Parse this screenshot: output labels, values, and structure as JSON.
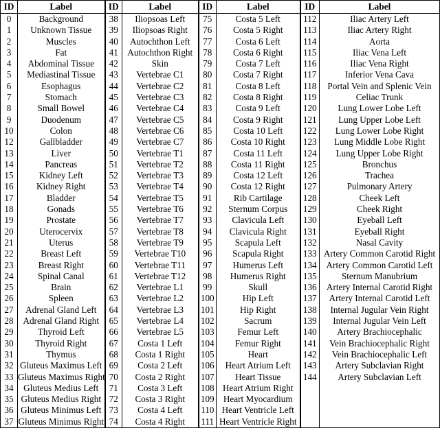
{
  "table": {
    "headers": {
      "id": "ID",
      "label": "Label"
    },
    "column_groups": [
      {
        "rows": [
          {
            "id": "0",
            "label": "Background"
          },
          {
            "id": "1",
            "label": "Unknown Tissue"
          },
          {
            "id": "2",
            "label": "Muscles"
          },
          {
            "id": "3",
            "label": "Fat"
          },
          {
            "id": "4",
            "label": "Abdominal Tissue"
          },
          {
            "id": "5",
            "label": "Mediastinal Tissue"
          },
          {
            "id": "6",
            "label": "Esophagus"
          },
          {
            "id": "7",
            "label": "Stomach"
          },
          {
            "id": "8",
            "label": "Small Bowel"
          },
          {
            "id": "9",
            "label": "Duodenum"
          },
          {
            "id": "10",
            "label": "Colon"
          },
          {
            "id": "12",
            "label": "Gallbladder"
          },
          {
            "id": "13",
            "label": "Liver"
          },
          {
            "id": "14",
            "label": "Pancreas"
          },
          {
            "id": "15",
            "label": "Kidney Left"
          },
          {
            "id": "16",
            "label": "Kidney Right"
          },
          {
            "id": "17",
            "label": "Bladder"
          },
          {
            "id": "18",
            "label": "Gonads"
          },
          {
            "id": "19",
            "label": "Prostate"
          },
          {
            "id": "20",
            "label": "Uterocervix"
          },
          {
            "id": "21",
            "label": "Uterus"
          },
          {
            "id": "22",
            "label": "Breast Left"
          },
          {
            "id": "23",
            "label": "Breast Right"
          },
          {
            "id": "24",
            "label": "Spinal Canal"
          },
          {
            "id": "25",
            "label": "Brain"
          },
          {
            "id": "26",
            "label": "Spleen"
          },
          {
            "id": "27",
            "label": "Adrenal Gland Left"
          },
          {
            "id": "28",
            "label": "Adrenal Gland Right"
          },
          {
            "id": "29",
            "label": "Thyroid Left"
          },
          {
            "id": "30",
            "label": "Thyroid Right"
          },
          {
            "id": "31",
            "label": "Thymus"
          },
          {
            "id": "32",
            "label": "Gluteus Maximus Left"
          },
          {
            "id": "33",
            "label": "Gluteus Maximus Right"
          },
          {
            "id": "34",
            "label": "Gluteus Medius Left"
          },
          {
            "id": "35",
            "label": "Gluteus Medius Right"
          },
          {
            "id": "36",
            "label": "Gluteus Minimus Left"
          },
          {
            "id": "37",
            "label": "Gluteus Minimus Right"
          }
        ]
      },
      {
        "rows": [
          {
            "id": "38",
            "label": "Iliopsoas Left"
          },
          {
            "id": "39",
            "label": "Iliopsoas Right"
          },
          {
            "id": "40",
            "label": "Autochthon Left"
          },
          {
            "id": "41",
            "label": "Autochthon Right"
          },
          {
            "id": "42",
            "label": "Skin"
          },
          {
            "id": "43",
            "label": "Vertebrae C1"
          },
          {
            "id": "44",
            "label": "Vertebrae C2"
          },
          {
            "id": "45",
            "label": "Vertebrae C3"
          },
          {
            "id": "46",
            "label": "Vertebrae C4"
          },
          {
            "id": "47",
            "label": "Vertebrae C5"
          },
          {
            "id": "48",
            "label": "Vertebrae C6"
          },
          {
            "id": "49",
            "label": "Vertebrae C7"
          },
          {
            "id": "50",
            "label": "Vertebrae T1"
          },
          {
            "id": "51",
            "label": "Vertebrae T2"
          },
          {
            "id": "52",
            "label": "Vertebrae T3"
          },
          {
            "id": "53",
            "label": "Vertebrae T4"
          },
          {
            "id": "54",
            "label": "Vertebrae T5"
          },
          {
            "id": "55",
            "label": "Vertebrae T6"
          },
          {
            "id": "56",
            "label": "Vertebrae T7"
          },
          {
            "id": "57",
            "label": "Vertebrae T8"
          },
          {
            "id": "58",
            "label": "Vertebrae T9"
          },
          {
            "id": "59",
            "label": "Vertebrae T10"
          },
          {
            "id": "60",
            "label": "Vertebrae T11"
          },
          {
            "id": "61",
            "label": "Vertebrae T12"
          },
          {
            "id": "62",
            "label": "Vertebrae L1"
          },
          {
            "id": "63",
            "label": "Vertebrae L2"
          },
          {
            "id": "64",
            "label": "Vertebrae L3"
          },
          {
            "id": "65",
            "label": "Vertebrae L4"
          },
          {
            "id": "66",
            "label": "Vertebrae L5"
          },
          {
            "id": "67",
            "label": "Costa 1 Left"
          },
          {
            "id": "68",
            "label": "Costa 1 Right"
          },
          {
            "id": "69",
            "label": "Costa 2 Left"
          },
          {
            "id": "70",
            "label": "Costa 2 Right"
          },
          {
            "id": "71",
            "label": "Costa 3 Left"
          },
          {
            "id": "72",
            "label": "Costa 3 Right"
          },
          {
            "id": "73",
            "label": "Costa 4 Left"
          },
          {
            "id": "74",
            "label": "Costa 4 Right"
          }
        ]
      },
      {
        "rows": [
          {
            "id": "75",
            "label": "Costa 5 Left"
          },
          {
            "id": "76",
            "label": "Costa 5 Right"
          },
          {
            "id": "77",
            "label": "Costa 6 Left"
          },
          {
            "id": "78",
            "label": "Costa 6 Right"
          },
          {
            "id": "79",
            "label": "Costa 7 Left"
          },
          {
            "id": "80",
            "label": "Costa 7 Right"
          },
          {
            "id": "81",
            "label": "Costa 8 Left"
          },
          {
            "id": "82",
            "label": "Costa 8 Right"
          },
          {
            "id": "83",
            "label": "Costa 9 Left"
          },
          {
            "id": "84",
            "label": "Costa 9 Right"
          },
          {
            "id": "85",
            "label": "Costa 10 Left"
          },
          {
            "id": "86",
            "label": "Costa 10 Right"
          },
          {
            "id": "87",
            "label": "Costa 11 Left"
          },
          {
            "id": "88",
            "label": "Costa 11 Right"
          },
          {
            "id": "89",
            "label": "Costa 12 Left"
          },
          {
            "id": "90",
            "label": "Costa 12 Right"
          },
          {
            "id": "91",
            "label": "Rib Cartilage"
          },
          {
            "id": "92",
            "label": "Sternum Corpus"
          },
          {
            "id": "93",
            "label": "Clavicula Left"
          },
          {
            "id": "94",
            "label": "Clavicula Right"
          },
          {
            "id": "95",
            "label": "Scapula Left"
          },
          {
            "id": "96",
            "label": "Scapula Right"
          },
          {
            "id": "97",
            "label": "Humerus Left"
          },
          {
            "id": "98",
            "label": "Humerus Right"
          },
          {
            "id": "99",
            "label": "Skull"
          },
          {
            "id": "100",
            "label": "Hip Left"
          },
          {
            "id": "101",
            "label": "Hip Right"
          },
          {
            "id": "102",
            "label": "Sacrum"
          },
          {
            "id": "103",
            "label": "Femur Left"
          },
          {
            "id": "104",
            "label": "Femur Right"
          },
          {
            "id": "105",
            "label": "Heart"
          },
          {
            "id": "106",
            "label": "Heart Atrium Left"
          },
          {
            "id": "107",
            "label": "Heart Tissue"
          },
          {
            "id": "108",
            "label": "Heart Atrium Right"
          },
          {
            "id": "109",
            "label": "Heart Myocardium"
          },
          {
            "id": "110",
            "label": "Heart Ventricle Left"
          },
          {
            "id": "111",
            "label": "Heart Ventricle Right"
          }
        ]
      },
      {
        "rows": [
          {
            "id": "112",
            "label": "Iliac Artery Left"
          },
          {
            "id": "113",
            "label": "Iliac Artery Right"
          },
          {
            "id": "114",
            "label": "Aorta"
          },
          {
            "id": "115",
            "label": "Iliac Vena Left"
          },
          {
            "id": "116",
            "label": "Iliac Vena Right"
          },
          {
            "id": "117",
            "label": "Inferior Vena Cava"
          },
          {
            "id": "118",
            "label": "Portal Vein and Splenic Vein"
          },
          {
            "id": "119",
            "label": "Celiac Trunk"
          },
          {
            "id": "120",
            "label": "Lung Lower Lobe Left"
          },
          {
            "id": "121",
            "label": "Lung Upper Lobe Left"
          },
          {
            "id": "122",
            "label": "Lung Lower Lobe Right"
          },
          {
            "id": "123",
            "label": "Lung Middle Lobe Right"
          },
          {
            "id": "124",
            "label": "Lung Upper Lobe Right"
          },
          {
            "id": "125",
            "label": "Bronchus"
          },
          {
            "id": "126",
            "label": "Trachea"
          },
          {
            "id": "127",
            "label": "Pulmonary Artery"
          },
          {
            "id": "128",
            "label": "Cheek Left"
          },
          {
            "id": "129",
            "label": "Cheek Right"
          },
          {
            "id": "130",
            "label": "Eyeball Left"
          },
          {
            "id": "131",
            "label": "Eyeball Right"
          },
          {
            "id": "132",
            "label": "Nasal Cavity"
          },
          {
            "id": "133",
            "label": "Artery Common Carotid Right"
          },
          {
            "id": "134",
            "label": "Artery Common Carotid Left"
          },
          {
            "id": "135",
            "label": "Sternum Manubrium"
          },
          {
            "id": "136",
            "label": "Artery Internal Carotid Right"
          },
          {
            "id": "137",
            "label": "Artery Internal Carotid Left"
          },
          {
            "id": "138",
            "label": "Internal Jugular Vein Right"
          },
          {
            "id": "139",
            "label": "Internal Jugular Vein Left"
          },
          {
            "id": "140",
            "label": "Artery Brachiocephalic"
          },
          {
            "id": "141",
            "label": "Vein Brachiocephalic Right"
          },
          {
            "id": "142",
            "label": "Vein Brachiocephalic Left"
          },
          {
            "id": "143",
            "label": "Artery Subclavian Right"
          },
          {
            "id": "144",
            "label": "Artery Subclavian Left"
          },
          {
            "id": "",
            "label": ""
          },
          {
            "id": "",
            "label": ""
          },
          {
            "id": "",
            "label": ""
          },
          {
            "id": "",
            "label": ""
          }
        ]
      }
    ]
  }
}
